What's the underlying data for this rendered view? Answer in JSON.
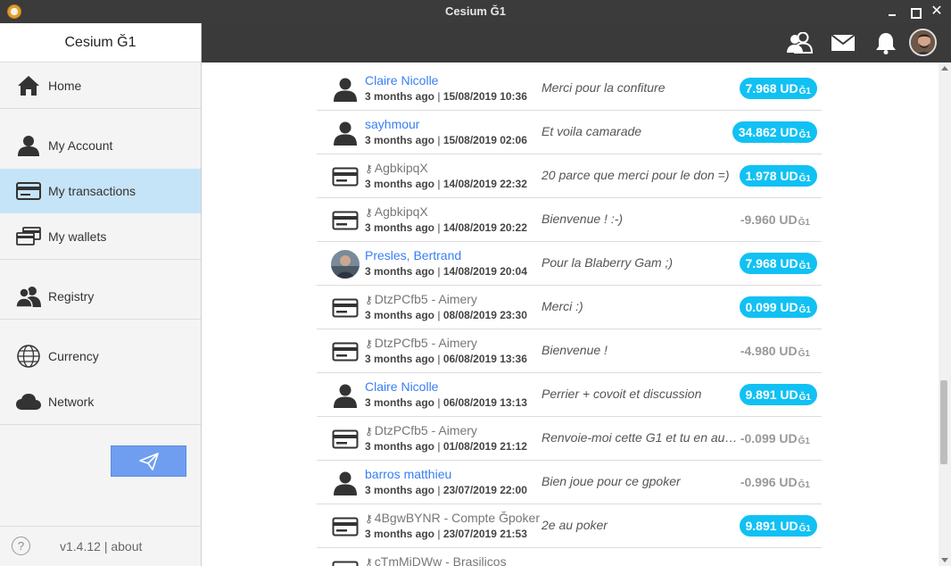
{
  "window": {
    "title": "Cesium Ğ1"
  },
  "sidebar": {
    "brand": "Cesium Ğ1",
    "items": [
      {
        "label": "Home",
        "icon": "home-icon"
      },
      {
        "label": "My Account",
        "icon": "person-icon"
      },
      {
        "label": "My transactions",
        "icon": "card-icon",
        "active": true
      },
      {
        "label": "My wallets",
        "icon": "wallets-icon"
      },
      {
        "label": "Registry",
        "icon": "people-icon"
      },
      {
        "label": "Currency",
        "icon": "globe-icon"
      },
      {
        "label": "Network",
        "icon": "cloud-icon"
      }
    ],
    "footer": {
      "help": "?",
      "version": "v1.4.12 | about"
    }
  },
  "colors": {
    "accent": "#11c1f3",
    "link": "#387ef5",
    "topbar": "#3a3a3a",
    "active_menu": "#c6e4f7",
    "send_button": "#6f9ef0"
  },
  "transactions": [
    {
      "name": "Claire Nicolle",
      "link": true,
      "icon": "person-icon",
      "date": "3 months ago",
      "datetime": "15/08/2019 10:36",
      "comment": "Merci pour la confiture",
      "amount": "7.968 UD",
      "unit": "Ğ1",
      "positive": true
    },
    {
      "name": "sayhmour",
      "link": true,
      "icon": "person-icon",
      "date": "3 months ago",
      "datetime": "15/08/2019 02:06",
      "comment": "Et voila camarade",
      "amount": "34.862 UD",
      "unit": "Ğ1",
      "positive": true
    },
    {
      "name": "AgbkipqX",
      "link": false,
      "key": true,
      "icon": "card-icon",
      "date": "3 months ago",
      "datetime": "14/08/2019 22:32",
      "comment": "20 parce que merci pour le don =)",
      "amount": "1.978 UD",
      "unit": "Ğ1",
      "positive": true
    },
    {
      "name": "AgbkipqX",
      "link": false,
      "key": true,
      "icon": "card-icon",
      "date": "3 months ago",
      "datetime": "14/08/2019 20:22",
      "comment": "Bienvenue ! :-)",
      "amount": "-9.960 UD",
      "unit": "Ğ1",
      "positive": false
    },
    {
      "name": "Presles, Bertrand",
      "link": true,
      "icon": "avatar-photo",
      "date": "3 months ago",
      "datetime": "14/08/2019 20:04",
      "comment": "Pour la Blaberry Gam ;)",
      "amount": "7.968 UD",
      "unit": "Ğ1",
      "positive": true
    },
    {
      "name": "DtzPCfb5 - Aimery",
      "link": false,
      "key": true,
      "icon": "card-icon",
      "date": "3 months ago",
      "datetime": "08/08/2019 23:30",
      "comment": "Merci :)",
      "amount": "0.099 UD",
      "unit": "Ğ1",
      "positive": true
    },
    {
      "name": "DtzPCfb5 - Aimery",
      "link": false,
      "key": true,
      "icon": "card-icon",
      "date": "3 months ago",
      "datetime": "06/08/2019 13:36",
      "comment": "Bienvenue !",
      "amount": "-4.980 UD",
      "unit": "Ğ1",
      "positive": false
    },
    {
      "name": "Claire Nicolle",
      "link": true,
      "icon": "person-icon",
      "date": "3 months ago",
      "datetime": "06/08/2019 13:13",
      "comment": "Perrier + covoit et discussion",
      "amount": "9.891 UD",
      "unit": "Ğ1",
      "positive": true
    },
    {
      "name": "DtzPCfb5 - Aimery",
      "link": false,
      "key": true,
      "icon": "card-icon",
      "date": "3 months ago",
      "datetime": "01/08/2019 21:12",
      "comment": "Renvoie-moi cette G1 et tu en aura...",
      "amount": "-0.099 UD",
      "unit": "Ğ1",
      "positive": false
    },
    {
      "name": "barros matthieu",
      "link": true,
      "icon": "person-icon",
      "date": "3 months ago",
      "datetime": "23/07/2019 22:00",
      "comment": "Bien joue pour ce gpoker",
      "amount": "-0.996 UD",
      "unit": "Ğ1",
      "positive": false
    },
    {
      "name": "4BgwBYNR - Compte Ğpoker",
      "link": false,
      "key": true,
      "icon": "card-icon",
      "date": "3 months ago",
      "datetime": "23/07/2019 21:53",
      "comment": "2e au poker",
      "amount": "9.891 UD",
      "unit": "Ğ1",
      "positive": true
    },
    {
      "name": "cTmMiDWw - Brasilicos",
      "link": false,
      "key": true,
      "icon": "card-icon",
      "partial": true
    }
  ]
}
